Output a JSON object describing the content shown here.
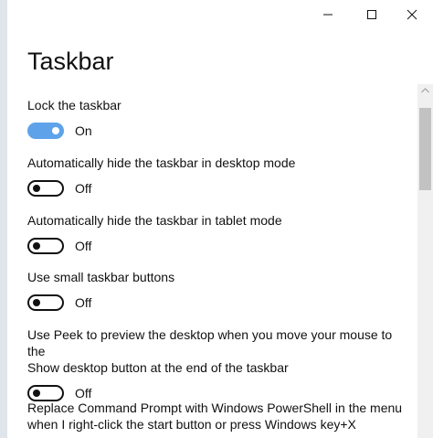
{
  "window": {
    "controls": {
      "minimize_icon": "minimize-icon",
      "maximize_icon": "maximize-icon",
      "close_icon": "close-icon"
    }
  },
  "page": {
    "title": "Taskbar"
  },
  "settings": [
    {
      "label": "Lock the taskbar",
      "state": "On",
      "on": true
    },
    {
      "label": "Automatically hide the taskbar in desktop mode",
      "state": "Off",
      "on": false
    },
    {
      "label": "Automatically hide the taskbar in tablet mode",
      "state": "Off",
      "on": false
    },
    {
      "label": "Use small taskbar buttons",
      "state": "Off",
      "on": false
    },
    {
      "label_line1": "Use Peek to preview the desktop when you move your mouse to the",
      "label_line2": "Show desktop button at the end of the taskbar",
      "state": "Off",
      "on": false
    },
    {
      "label_line1": "Replace Command Prompt with Windows PowerShell in the menu",
      "label_line2": "when I right-click the start button or press Windows key+X"
    }
  ],
  "colors": {
    "toggle_on": "#5ea3ea",
    "text": "#111111",
    "background": "#ffffff"
  }
}
